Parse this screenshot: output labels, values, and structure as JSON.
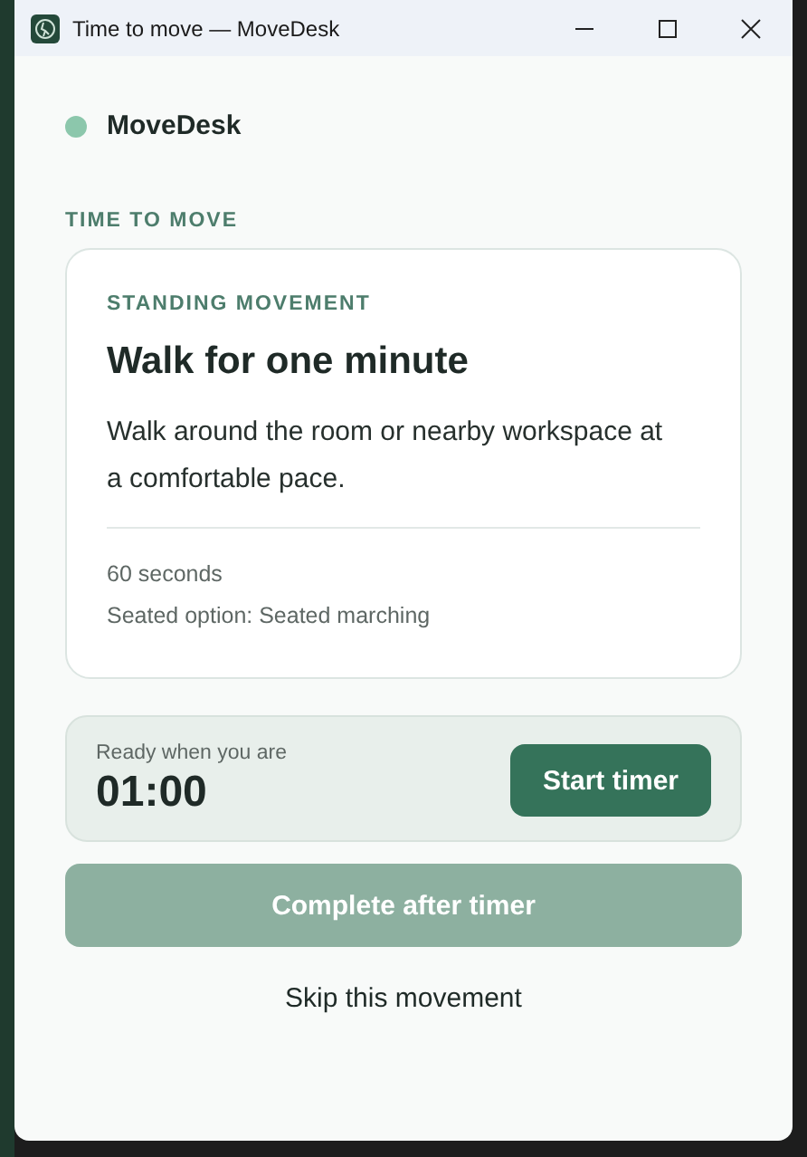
{
  "window": {
    "title": "Time to move — MoveDesk"
  },
  "app": {
    "name": "MoveDesk"
  },
  "section_label": "TIME TO MOVE",
  "movement": {
    "category": "STANDING MOVEMENT",
    "title": "Walk for one minute",
    "description": "Walk around the room or nearby workspace at a comfortable pace.",
    "details": [
      "60 seconds",
      "Seated option: Seated marching"
    ]
  },
  "timer": {
    "caption": "Ready when you are",
    "time": "01:00",
    "button": "Start timer"
  },
  "complete_button": {
    "label": "Complete after timer",
    "disabled": true
  },
  "skip_link": "Skip this movement"
}
